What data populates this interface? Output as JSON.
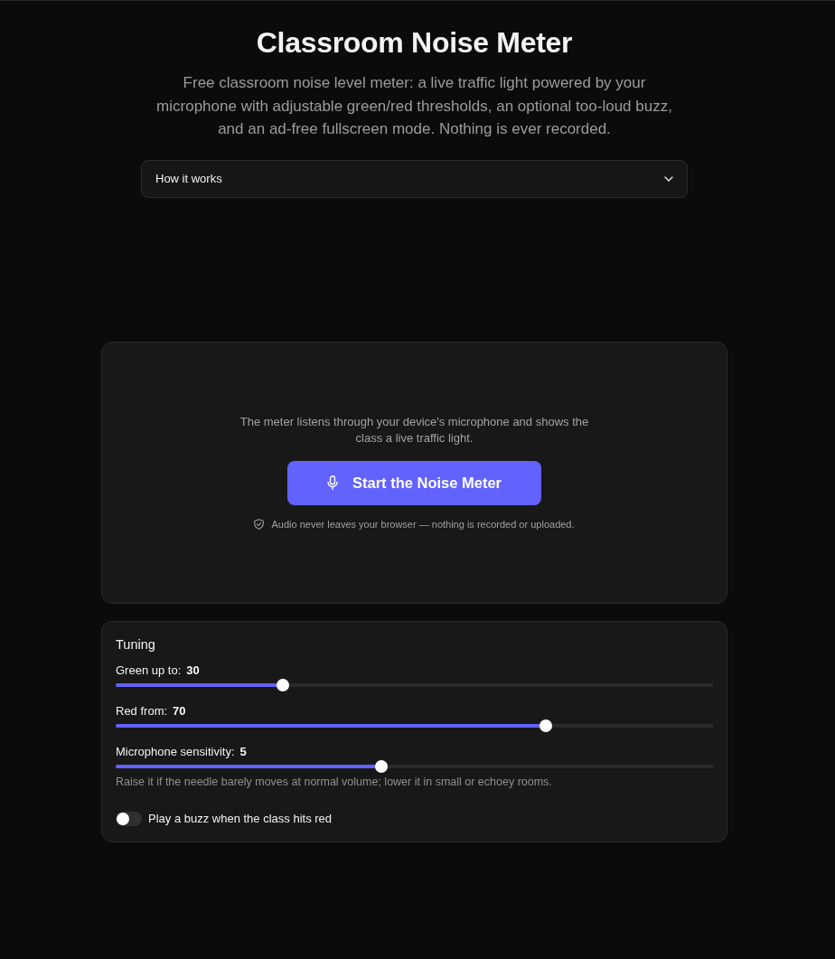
{
  "header": {
    "title": "Classroom Noise Meter",
    "subtitle": "Free classroom noise level meter: a live traffic light powered by your microphone with adjustable green/red thresholds, an optional too-loud buzz, and an ad-free fullscreen mode. Nothing is ever recorded."
  },
  "how_it_works": {
    "label": "How it works",
    "expanded": false
  },
  "start_panel": {
    "intro": "The meter listens through your device's microphone and shows the class a live traffic light.",
    "button": "Start the Noise Meter",
    "privacy_note": "Audio never leaves your browser — nothing is recorded or uploaded."
  },
  "tuning": {
    "title": "Tuning",
    "sliders": [
      {
        "label": "Green up to:",
        "value": "30",
        "level": 0.28
      },
      {
        "label": "Red from:",
        "value": "70",
        "level": 0.72
      },
      {
        "label": "Microphone sensitivity:",
        "value": "5",
        "level": 0.445,
        "hint": "Raise it if the needle barely moves at normal volume; lower it in small or echoey rooms."
      }
    ],
    "buzz": {
      "label": "Play a buzz when the class hits red",
      "on": false
    }
  }
}
